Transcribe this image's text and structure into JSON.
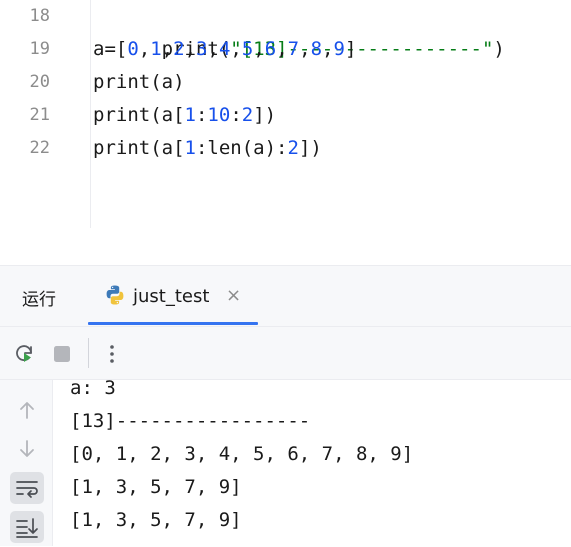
{
  "editor": {
    "lines": [
      {
        "num": "18",
        "parts": [
          [
            "kw",
            "print("
          ],
          [
            "str",
            "\"[13]-----------------\""
          ],
          [
            "kw",
            ")"
          ]
        ]
      },
      {
        "num": "19",
        "parts": [
          [
            "kw",
            "a=["
          ],
          [
            "num",
            "0"
          ],
          [
            "kw",
            ","
          ],
          [
            "num",
            "1"
          ],
          [
            "kw",
            ","
          ],
          [
            "num",
            "2"
          ],
          [
            "kw",
            ","
          ],
          [
            "num",
            "3"
          ],
          [
            "kw",
            ","
          ],
          [
            "num",
            "4"
          ],
          [
            "kw",
            ","
          ],
          [
            "num",
            "5"
          ],
          [
            "kw",
            ","
          ],
          [
            "num",
            "6"
          ],
          [
            "kw",
            ","
          ],
          [
            "num",
            "7"
          ],
          [
            "kw",
            ","
          ],
          [
            "num",
            "8"
          ],
          [
            "kw",
            ","
          ],
          [
            "num",
            "9"
          ],
          [
            "kw",
            "]"
          ]
        ]
      },
      {
        "num": "20",
        "parts": [
          [
            "kw",
            "print(a)"
          ]
        ]
      },
      {
        "num": "21",
        "parts": [
          [
            "kw",
            "print(a["
          ],
          [
            "num",
            "1"
          ],
          [
            "kw",
            ":"
          ],
          [
            "num",
            "10"
          ],
          [
            "kw",
            ":"
          ],
          [
            "num",
            "2"
          ],
          [
            "kw",
            "])"
          ]
        ]
      },
      {
        "num": "22",
        "parts": [
          [
            "kw",
            "print(a["
          ],
          [
            "num",
            "1"
          ],
          [
            "kw",
            ":len(a):"
          ],
          [
            "num",
            "2"
          ],
          [
            "kw",
            "])"
          ]
        ]
      }
    ]
  },
  "run_panel": {
    "label": "运行",
    "tab_title": "just_test",
    "tab_close": "×",
    "tab_icon": "python-icon"
  },
  "toolbar": {
    "rerun_icon": "rerun-icon",
    "stop_icon": "stop-icon",
    "more_icon": "more-vertical-icon"
  },
  "sidebar": {
    "icons": [
      "arrow-up-icon",
      "arrow-down-icon",
      "soft-wrap-icon",
      "scroll-to-end-icon"
    ]
  },
  "output": {
    "lines": [
      "a: 3",
      "[13]-----------------",
      "[0, 1, 2, 3, 4, 5, 6, 7, 8, 9]",
      "[1, 3, 5, 7, 9]",
      "[1, 3, 5, 7, 9]"
    ]
  }
}
